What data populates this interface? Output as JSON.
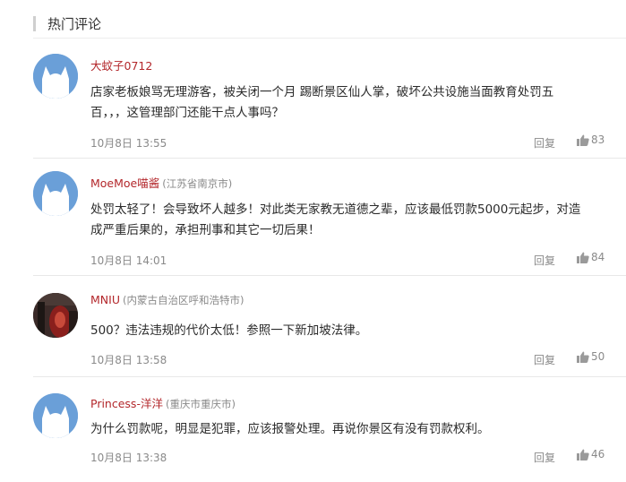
{
  "section": {
    "title": "热门评论"
  },
  "comments": [
    {
      "username": "大蚊子0712",
      "location": "",
      "text_lines": [
        "店家老板娘骂无理游客，被关闭一个月 踢断景区仙人掌，破坏公共设施当面教育处罚五",
        "百，，，这管理部门还能干点人事吗？"
      ],
      "time": "10月8日 13:55",
      "reply_label": "回复",
      "likes": "83",
      "avatar_icon": "default-user-avatar-icon"
    },
    {
      "username": "MoeMoe喵酱",
      "location": "(江苏省南京市)",
      "text_lines": [
        "处罚太轻了！会导致坏人越多！对此类无家教无道德之辈，应该最低罚款5000元起步，对造",
        "成严重后果的，承担刑事和其它一切后果！"
      ],
      "time": "10月8日 14:01",
      "reply_label": "回复",
      "likes": "84",
      "avatar_icon": "default-user-avatar-icon"
    },
    {
      "username": "MNIU",
      "location": "(内蒙古自治区呼和浩特市)",
      "text_lines": [
        "500？违法违规的代价太低！参照一下新加坡法律。"
      ],
      "time": "10月8日 13:58",
      "reply_label": "回复",
      "likes": "50",
      "avatar_icon": "photo-avatar-icon"
    },
    {
      "username": "Princess-洋洋",
      "location": "(重庆市重庆市)",
      "text_lines": [
        "为什么罚款呢，明显是犯罪，应该报警处理。再说你景区有没有罚款权利。"
      ],
      "time": "10月8日 13:38",
      "reply_label": "回复",
      "likes": "46",
      "avatar_icon": "default-user-avatar-icon"
    }
  ],
  "colors": {
    "username": "#b3272b",
    "meta_gray": "#8a8a8a",
    "avatar_blue": "#6a9fd8"
  }
}
